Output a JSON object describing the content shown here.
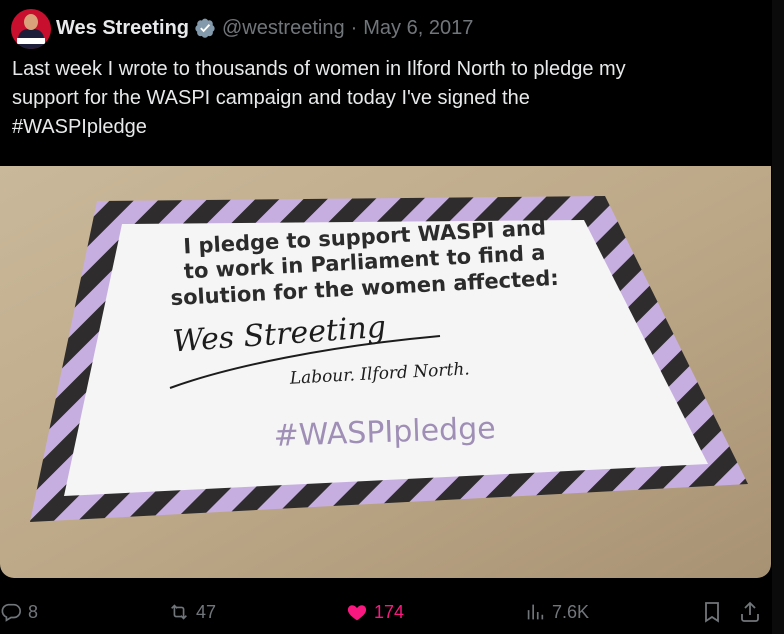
{
  "author": {
    "name": "Wes Streeting",
    "handle": "@westreeting",
    "date": "May 6, 2017"
  },
  "tweet": {
    "lines": [
      "Last week I wrote to thousands of women in Ilford North to pledge my",
      "support for the WASPI campaign and today I've signed the",
      "#WASPIpledge"
    ]
  },
  "image": {
    "pledge_lines": [
      "I pledge to support WASPI and",
      "to work in Parliament to find a",
      "solution for the women affected:"
    ],
    "signature": "Wes Streeting",
    "signature_sub": "Labour. Ilford North.",
    "hashtag": "#WASPIpledge"
  },
  "actions": {
    "replies": "8",
    "reposts": "47",
    "likes": "174",
    "views": "7.6K"
  },
  "colors": {
    "accent_like": "#f91880",
    "muted": "#71767b",
    "verified": "#829aab"
  },
  "icons": [
    "reply-icon",
    "repost-icon",
    "heart-icon",
    "views-icon",
    "bookmark-icon",
    "share-icon"
  ]
}
